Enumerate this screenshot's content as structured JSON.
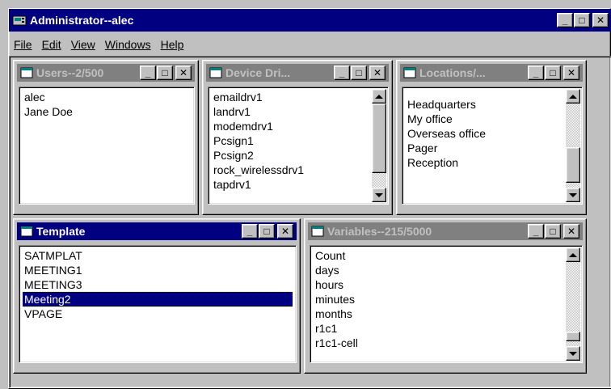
{
  "app": {
    "title": "Administrator--alec",
    "controls": {
      "minimize": "_",
      "maximize": "□",
      "close": "✕"
    }
  },
  "menu": [
    "File",
    "Edit",
    "View",
    "Windows",
    "Help"
  ],
  "windows": {
    "users": {
      "title": "Users--2/500",
      "items": [
        "alec",
        "Jane Doe"
      ]
    },
    "drivers": {
      "title": "Device Dri...",
      "items": [
        "emaildrv1",
        "landrv1",
        "modemdrv1",
        "Pcsign1",
        "Pcsign2",
        "rock_wirelessdrv1",
        "tapdrv1"
      ]
    },
    "locations": {
      "title": "Locations/...",
      "items": [
        "Headquarters",
        "My office",
        "Overseas office",
        "Pager",
        "Reception"
      ]
    },
    "template": {
      "title": "Template",
      "items": [
        "SATMPLAT",
        "MEETING1",
        "MEETING3",
        "Meeting2",
        "VPAGE"
      ],
      "selected": "Meeting2"
    },
    "variables": {
      "title": "Variables--215/5000",
      "items": [
        "Count",
        "days",
        "hours",
        "minutes",
        "months",
        "r1c1",
        "r1c1-cell"
      ]
    }
  },
  "colors": {
    "active_title": "#000080",
    "inactive_title": "#808080",
    "face": "#c0c0c0"
  },
  "icons": {
    "app": "pager-icon",
    "window": "window-icon"
  }
}
